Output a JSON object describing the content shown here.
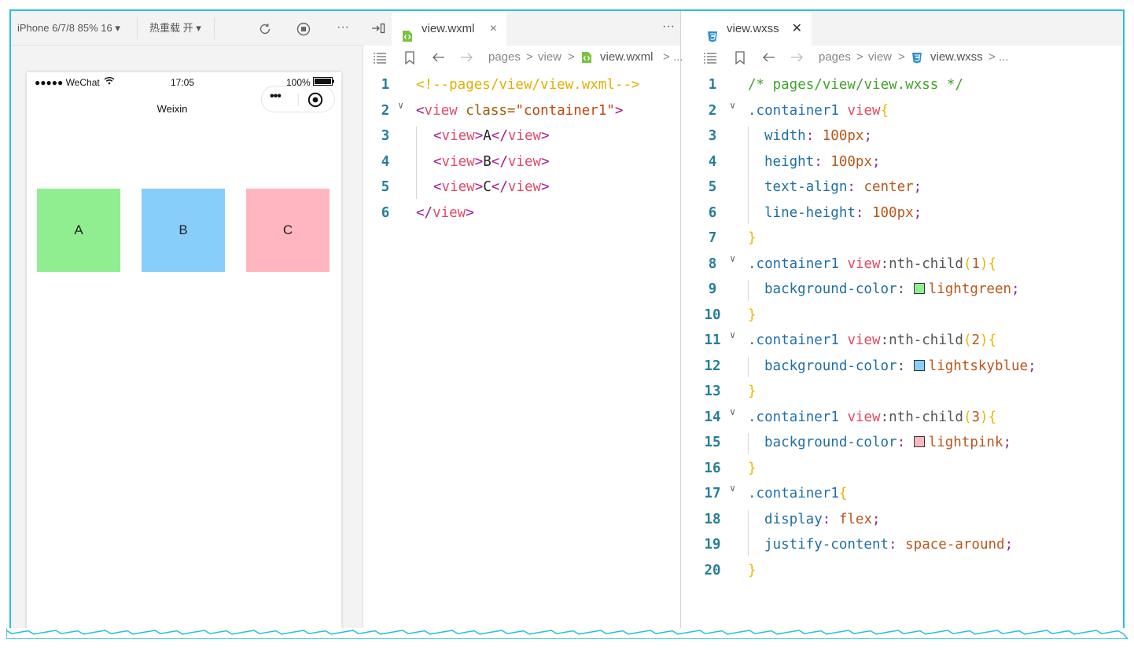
{
  "simulator": {
    "device": "iPhone 6/7/8 85% 16 ▾",
    "hot_reload": "热重载 开 ▾",
    "status": {
      "carrier": "●●●●● WeChat",
      "time": "17:05",
      "battery": "100%"
    },
    "nav_title": "Weixin",
    "capsule_more": "•••",
    "boxes": [
      {
        "label": "A",
        "color": "#90ee90"
      },
      {
        "label": "B",
        "color": "#87cefa"
      },
      {
        "label": "C",
        "color": "#ffb6c1"
      }
    ]
  },
  "wxml_editor": {
    "tab": {
      "label": "view.wxml",
      "close": "×"
    },
    "more": "···",
    "breadcrumb": {
      "p1": "pages",
      "p2": "view",
      "file": "view.wxml",
      "sep": ">",
      "ellipsis": "..."
    },
    "lines": [
      {
        "n": "1",
        "comment": "<!--pages/view/view.wxml-->"
      },
      {
        "n": "2",
        "open": "<",
        "tag": "view",
        "attr": " class=",
        "str": "\"container1\"",
        "close": ">"
      },
      {
        "n": "3",
        "open": "<",
        "tag": "view",
        "mid": ">",
        "text": "A",
        "end_open": "</",
        "end_tag": "view",
        "end_close": ">"
      },
      {
        "n": "4",
        "open": "<",
        "tag": "view",
        "mid": ">",
        "text": "B",
        "end_open": "</",
        "end_tag": "view",
        "end_close": ">"
      },
      {
        "n": "5",
        "open": "<",
        "tag": "view",
        "mid": ">",
        "text": "C",
        "end_open": "</",
        "end_tag": "view",
        "end_close": ">"
      },
      {
        "n": "6",
        "open": "</",
        "tag": "view",
        "close": ">"
      }
    ]
  },
  "wxss_editor": {
    "tab": {
      "label": "view.wxss",
      "close": "✕"
    },
    "breadcrumb": {
      "p1": "pages",
      "p2": "view",
      "file": "view.wxss",
      "sep": ">",
      "ellipsis": "..."
    },
    "lines": [
      {
        "n": "1",
        "comment": "/* pages/view/view.wxss */"
      },
      {
        "n": "2",
        "sel": ".container1 ",
        "selt": "view",
        "brace": "{"
      },
      {
        "n": "3",
        "prop": "width",
        "colon": ": ",
        "val": "100px",
        "semi": ";"
      },
      {
        "n": "4",
        "prop": "height",
        "colon": ": ",
        "val": "100px",
        "semi": ";"
      },
      {
        "n": "5",
        "prop": "text-align",
        "colon": ": ",
        "val": "center",
        "semi": ";"
      },
      {
        "n": "6",
        "prop": "line-height",
        "colon": ": ",
        "val": "100px",
        "semi": ";"
      },
      {
        "n": "7",
        "brace": "}"
      },
      {
        "n": "8",
        "sel": ".container1 ",
        "selt": "view",
        "pseudo": ":nth-child",
        "po": "(",
        "arg": "1",
        "pc": ")",
        "brace": "{"
      },
      {
        "n": "9",
        "prop": "background-color",
        "colon": ": ",
        "val": "lightgreen",
        "semi": ";",
        "swatch": "#90ee90"
      },
      {
        "n": "10",
        "brace": "}"
      },
      {
        "n": "11",
        "sel": ".container1 ",
        "selt": "view",
        "pseudo": ":nth-child",
        "po": "(",
        "arg": "2",
        "pc": ")",
        "brace": "{"
      },
      {
        "n": "12",
        "prop": "background-color",
        "colon": ": ",
        "val": "lightskyblue",
        "semi": ";",
        "swatch": "#87cefa"
      },
      {
        "n": "13",
        "brace": "}"
      },
      {
        "n": "14",
        "sel": ".container1 ",
        "selt": "view",
        "pseudo": ":nth-child",
        "po": "(",
        "arg": "3",
        "pc": ")",
        "brace": "{"
      },
      {
        "n": "15",
        "prop": "background-color",
        "colon": ": ",
        "val": "lightpink",
        "semi": ";",
        "swatch": "#ffb6c1"
      },
      {
        "n": "16",
        "brace": "}"
      },
      {
        "n": "17",
        "sel": ".container1",
        "brace": "{"
      },
      {
        "n": "18",
        "prop": "display",
        "colon": ": ",
        "val": "flex",
        "semi": ";"
      },
      {
        "n": "19",
        "prop": "justify-content",
        "colon": ": ",
        "val": "space-around",
        "semi": ";"
      },
      {
        "n": "20",
        "brace": "}"
      }
    ]
  },
  "colors": {
    "frame_border": "#27c0dc",
    "wxml_icon": "#7cc242",
    "css_icon": "#2e8fd6"
  }
}
